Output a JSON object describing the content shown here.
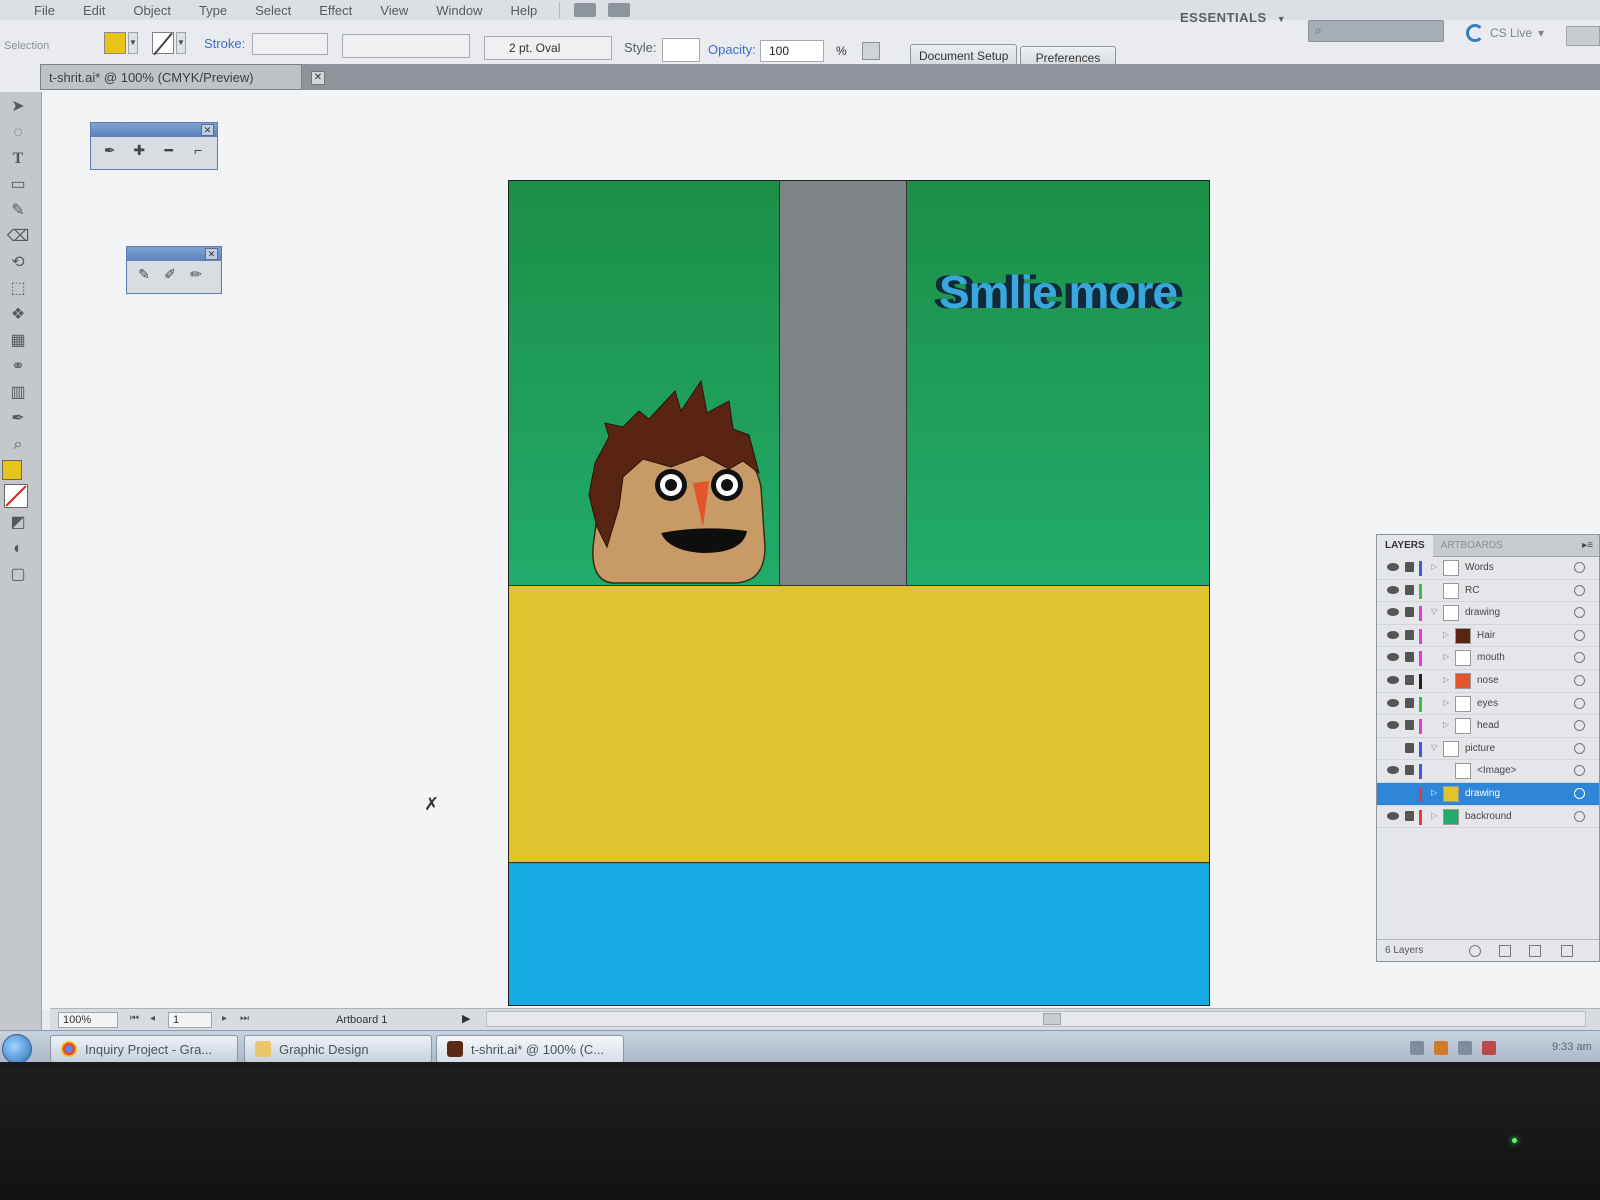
{
  "menubar": {
    "items": [
      "File",
      "Edit",
      "Object",
      "Type",
      "Select",
      "Effect",
      "View",
      "Window",
      "Help"
    ],
    "workspace_label": "ESSENTIALS",
    "workspace_arrow": "▼",
    "search_icon": "⌕",
    "cslive_label": "CS Live",
    "cslive_arrow": "▾"
  },
  "control_bar": {
    "selection_label": "Selection",
    "fill_color": "#e8c418",
    "stroke_label": "Stroke:",
    "brush_value": "2 pt. Oval",
    "style_label": "Style:",
    "opacity_label": "Opacity:",
    "opacity_value": "100",
    "opacity_unit": "%",
    "document_setup_label": "Document Setup",
    "preferences_label": "Preferences"
  },
  "document_tab": {
    "title": "t-shrit.ai* @ 100% (CMYK/Preview)",
    "close_glyph": "✕"
  },
  "mini_panels": {
    "pen_tools": {
      "close_glyph": "✕",
      "tools": [
        "pen-icon",
        "add-anchor-icon",
        "delete-anchor-icon",
        "convert-anchor-icon"
      ]
    },
    "pencil_tools": {
      "close_glyph": "✕",
      "tools": [
        "pencil-icon",
        "smooth-icon",
        "path-eraser-icon"
      ]
    }
  },
  "artboard": {
    "text": "Smlie more",
    "colors": {
      "sky": "#1c8f46",
      "pillar": "#7e8486",
      "ground": "#e0c42e",
      "water": "#18ace4",
      "text_fill": "#38a7dc",
      "hair": "#5a2412",
      "skin": "#c89a66",
      "nose": "#e4542a"
    }
  },
  "status_bar": {
    "zoom": "100%",
    "page": "1",
    "artboard_label": "Artboard 1",
    "first_glyph": "⏮",
    "prev_glyph": "◂",
    "next_glyph": "▸",
    "last_glyph": "⏭",
    "arrow_glyph": "▶"
  },
  "layers_panel": {
    "tabs": [
      "LAYERS",
      "ARTBOARDS"
    ],
    "menu_glyph": "▸≡",
    "rows": [
      {
        "name": "Words",
        "color": "#3b5bdc"
      },
      {
        "name": "RC",
        "color": "#3cbf3c"
      },
      {
        "name": "drawing",
        "color": "#e43ad8"
      },
      {
        "name": "Hair",
        "color": "#e43ad8"
      },
      {
        "name": "mouth",
        "color": "#e43ad8"
      },
      {
        "name": "nose",
        "color": "#222222"
      },
      {
        "name": "eyes",
        "color": "#3cbf3c"
      },
      {
        "name": "head",
        "color": "#e43ad8"
      },
      {
        "name": "picture",
        "color": "#3b5bdc"
      },
      {
        "name": "<Image>",
        "color": "#3b5bdc"
      },
      {
        "name": "drawing",
        "color": "#e43a3a"
      },
      {
        "name": "backround",
        "color": "#e43a3a"
      }
    ],
    "layer_count": "6 Layers"
  },
  "taskbar": {
    "buttons": [
      {
        "label": "Inquiry Project - Gra..."
      },
      {
        "label": "Graphic Design"
      },
      {
        "label": "t-shrit.ai* @ 100% (C..."
      }
    ],
    "clock": "9:33 am"
  }
}
